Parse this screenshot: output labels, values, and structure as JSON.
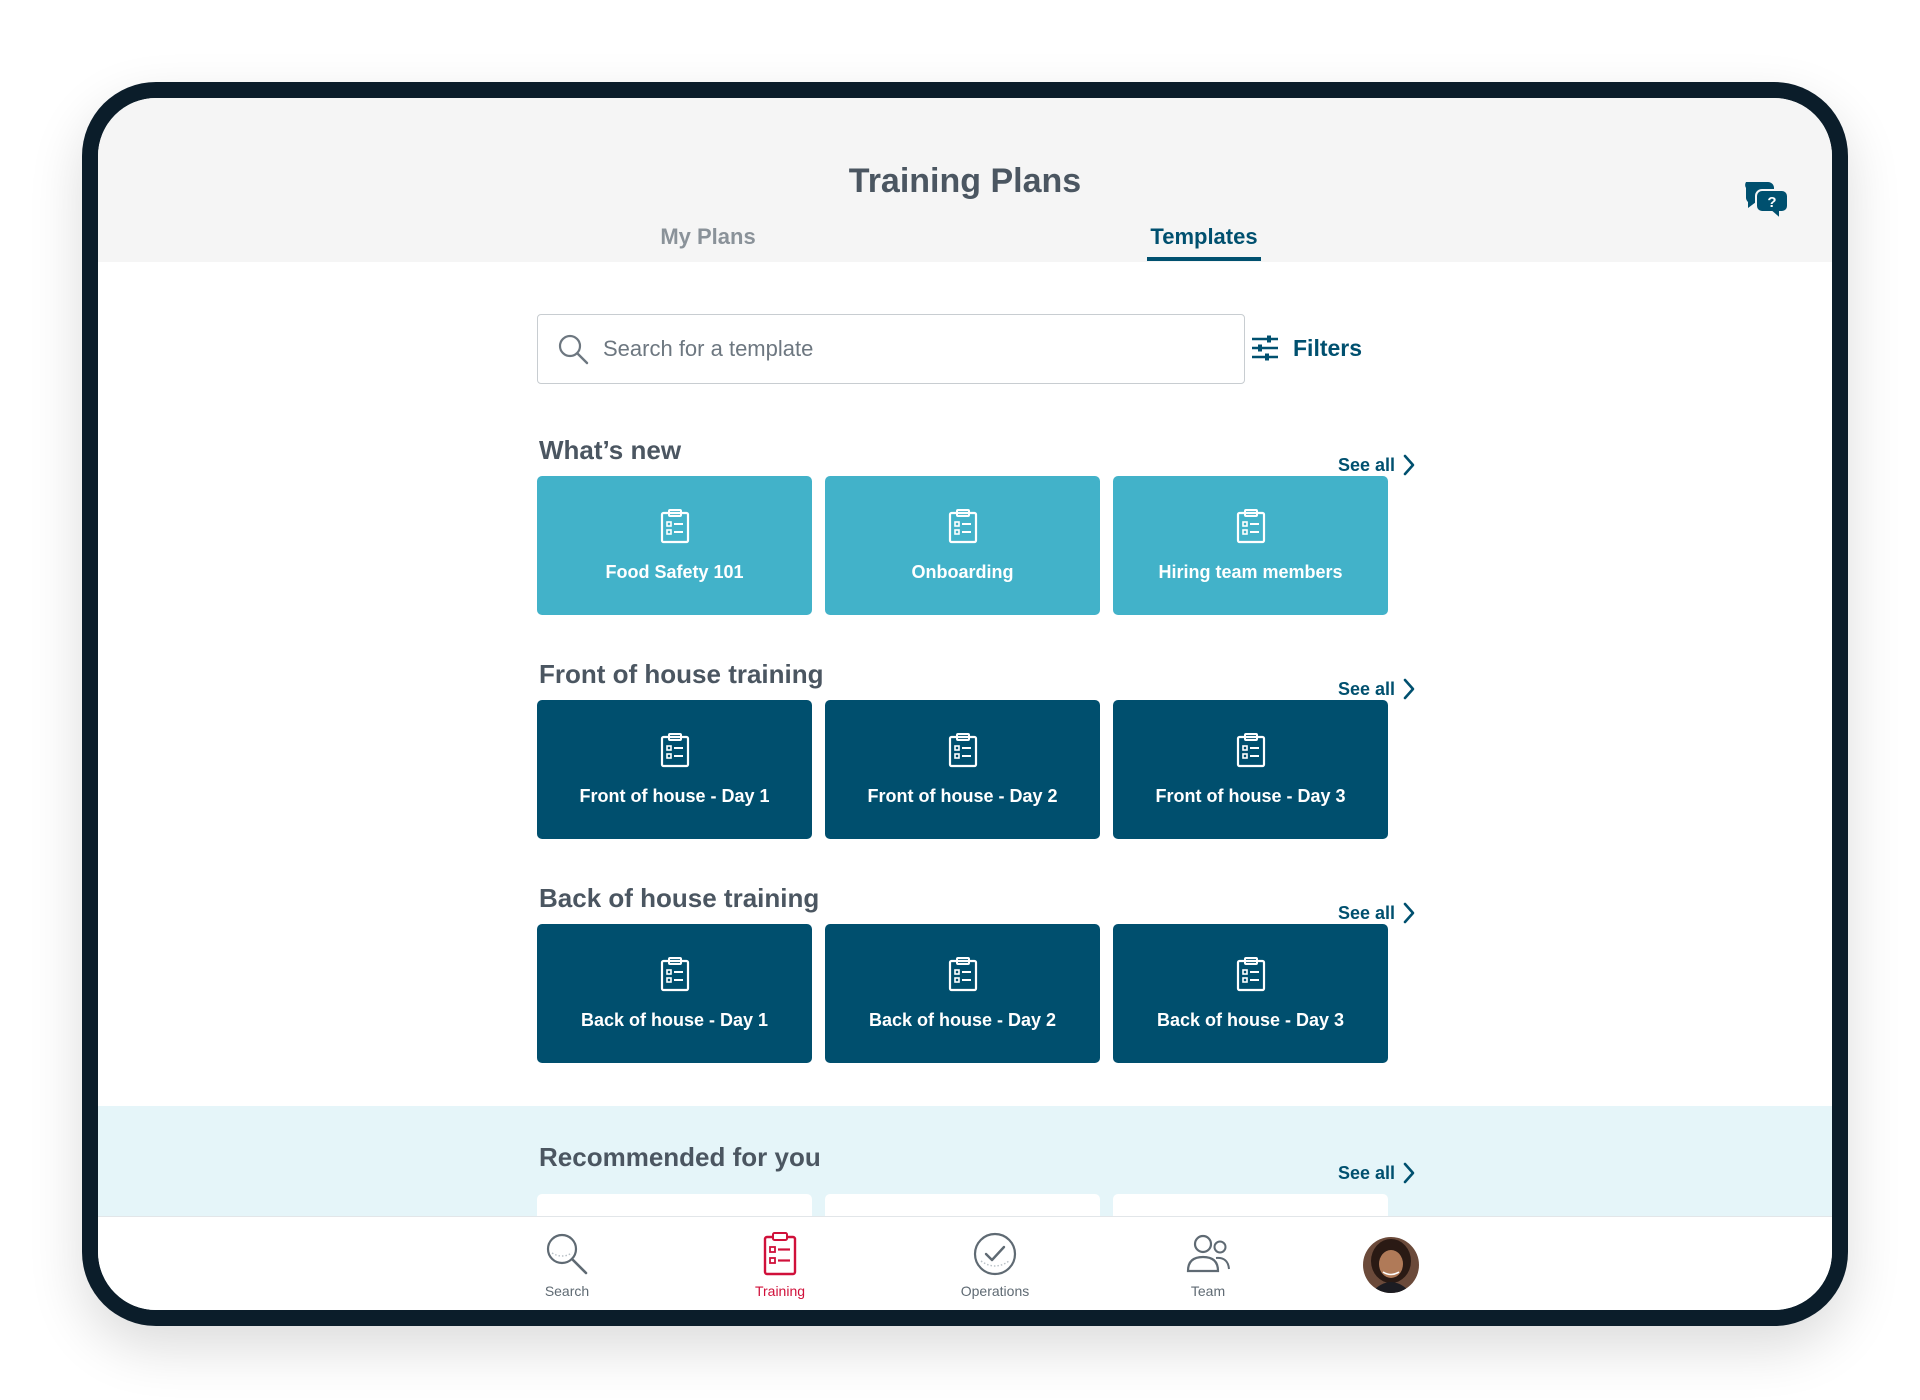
{
  "header": {
    "title": "Training Plans",
    "tabs": [
      {
        "label": "My Plans",
        "active": false
      },
      {
        "label": "Templates",
        "active": true
      }
    ],
    "help_icon": "chat-help-icon"
  },
  "search": {
    "placeholder": "Search for a template",
    "value": "",
    "filters_label": "Filters"
  },
  "sections": [
    {
      "title": "What’s new",
      "see_all": "See all",
      "style": "teal",
      "cards": [
        {
          "label": "Food Safety 101"
        },
        {
          "label": "Onboarding"
        },
        {
          "label": "Hiring team members"
        }
      ]
    },
    {
      "title": "Front of house training",
      "see_all": "See all",
      "style": "navy",
      "cards": [
        {
          "label": "Front of house - Day 1"
        },
        {
          "label": "Front of house - Day 2"
        },
        {
          "label": "Front of house - Day 3"
        }
      ]
    },
    {
      "title": "Back of house training",
      "see_all": "See all",
      "style": "navy",
      "cards": [
        {
          "label": "Back of house - Day 1"
        },
        {
          "label": "Back of house - Day 2"
        },
        {
          "label": "Back of house - Day 3"
        }
      ]
    }
  ],
  "recommended": {
    "title": "Recommended for you",
    "see_all": "See all"
  },
  "bottom_nav": [
    {
      "label": "Search",
      "icon": "search-icon",
      "active": false
    },
    {
      "label": "Training",
      "icon": "clipboard-icon",
      "active": true
    },
    {
      "label": "Operations",
      "icon": "checkmark-circle-icon",
      "active": false
    },
    {
      "label": "Team",
      "icon": "team-icon",
      "active": false
    }
  ],
  "colors": {
    "primary": "#00506f",
    "teal_card": "#42b2c9",
    "navy_card": "#004f6e",
    "active_nav": "#d0103a",
    "recommended_bg": "#e5f5f9"
  }
}
